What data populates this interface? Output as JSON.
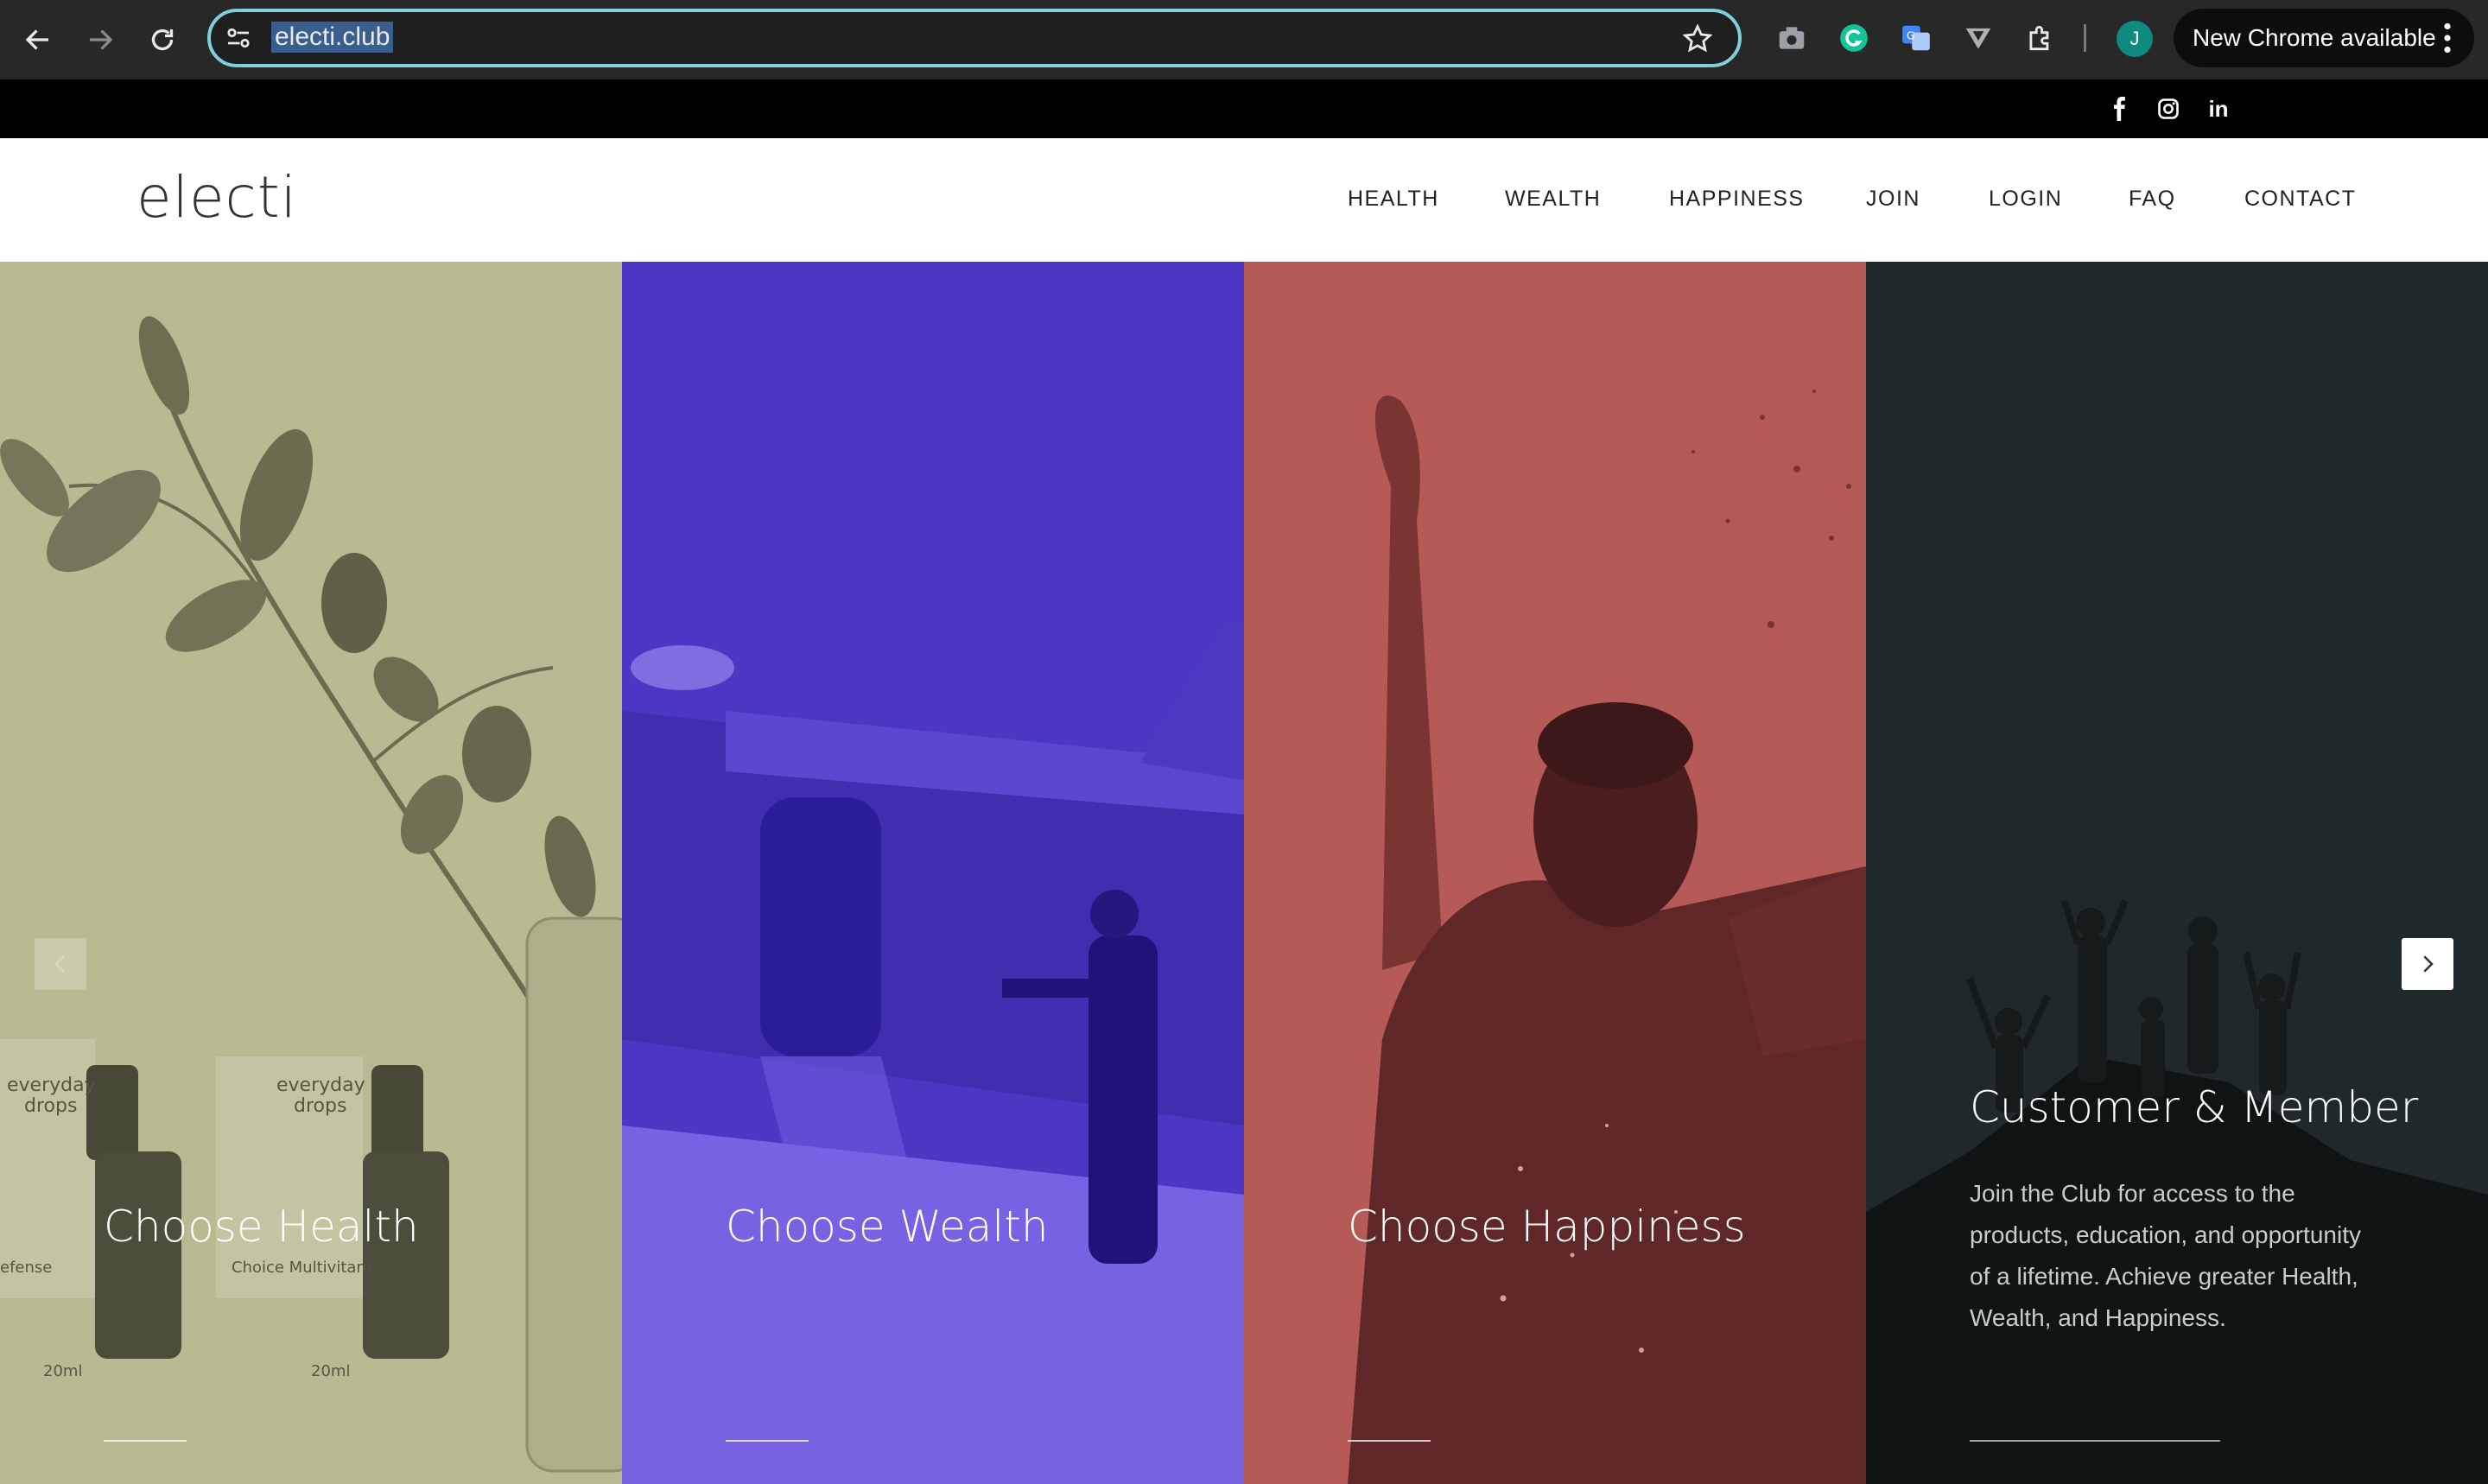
{
  "browser": {
    "url": "electi.club",
    "update_label": "New Chrome available",
    "profile_initial": "J"
  },
  "social": {
    "icons": [
      "facebook-icon",
      "instagram-icon",
      "linkedin-icon"
    ],
    "linkedin_label": "in"
  },
  "header": {
    "logo": "electi",
    "nav": [
      "HEALTH",
      "WEALTH",
      "HAPPINESS",
      "JOIN",
      "LOGIN",
      "FAQ",
      "CONTACT"
    ]
  },
  "hero": {
    "panels": [
      {
        "title": "Choose Health",
        "color": "#b9ba92"
      },
      {
        "title": "Choose Wealth",
        "color": "#4c37c4"
      },
      {
        "title": "Choose Happiness",
        "color": "#b55a57"
      },
      {
        "title": "Customer & Member",
        "color": "#1f282a",
        "description": "Join the Club for access to the products, education, and opportunity of a lifetime. Achieve greater Health, Wealth, and Happiness."
      }
    ],
    "product_labels": [
      "everyday drops",
      "everyday drops",
      "Choice Multivitam",
      "20ml",
      "20ml",
      "efense"
    ]
  }
}
